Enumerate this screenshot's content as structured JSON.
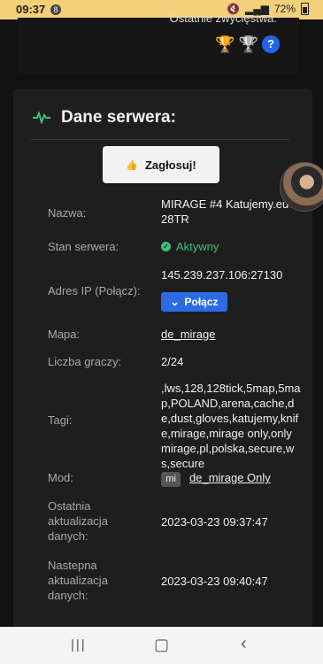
{
  "status_bar": {
    "time": "09:37",
    "notification_count": "8",
    "battery": "72%"
  },
  "top_panel": {
    "last_wins_label": "Ostatnie zwycięstwa:",
    "help_icon_text": "?"
  },
  "server_card": {
    "title": "Dane serwera:",
    "vote_label": "Zagłosuj!",
    "fields": {
      "name_label": "Nazwa:",
      "name_value": "MIRAGE #4 Katujemy.eu 128TR",
      "status_label": "Stan serwera:",
      "status_value": "Aktywny",
      "ip_label": "Adres IP (Połącz):",
      "ip_value": "145.239.237.106:27130",
      "connect_label": "Połącz",
      "map_label": "Mapa:",
      "map_value": "de_mirage",
      "players_label": "Liczba graczy:",
      "players_value": "2/24",
      "tags_label": "Tagi:",
      "tags_value": ",lws,128,128tick,5map,5map,POLAND,arena,cache,de,dust,gloves,katujemy,knife,mirage,mirage only,only mirage,pl,polska,secure,ws,secure",
      "mod_label": "Mod:",
      "mod_badge": "mi",
      "mod_value": "de_mirage Only",
      "last_update_label": "Ostatnia aktualizacja danych:",
      "last_update_value": "2023-03-23 09:37:47",
      "next_update_label": "Nastepna aktualizacja danych:",
      "next_update_value": "2023-03-23 09:40:47"
    }
  },
  "colors": {
    "accent": "#2d6be4",
    "active_green": "#3cc17a",
    "status_bar": "#f4d07a"
  }
}
